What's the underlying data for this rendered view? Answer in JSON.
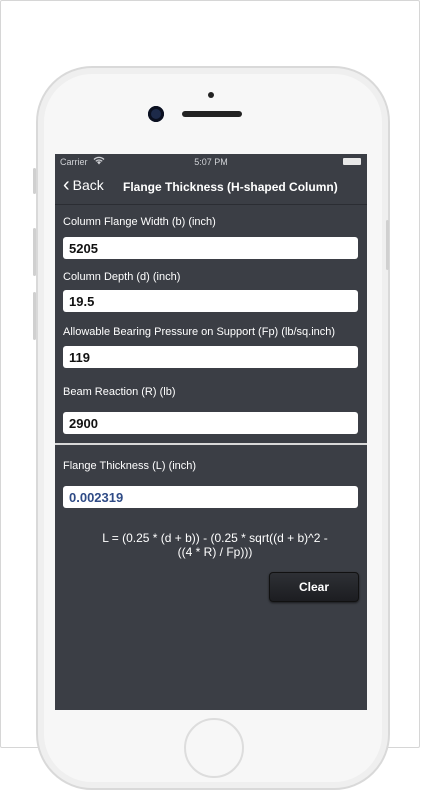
{
  "status": {
    "carrier": "Carrier",
    "time": "5:07 PM"
  },
  "nav": {
    "back_label": "Back",
    "title": "Flange Thickness (H-shaped Column)"
  },
  "fields": [
    {
      "label": "Column Flange Width (b) (inch)",
      "value": "5205"
    },
    {
      "label": "Column Depth (d) (inch)",
      "value": "19.5"
    },
    {
      "label": "Allowable Bearing Pressure on Support (Fp) (lb/sq.inch)",
      "value": "119"
    },
    {
      "label": "Beam Reaction (R) (lb)",
      "value": "2900"
    }
  ],
  "result": {
    "label": "Flange Thickness (L) (inch)",
    "value": "0.002319"
  },
  "formula": {
    "line1": "L = (0.25 * (d + b)) - (0.25 * sqrt((d + b)^2 -",
    "line2": "((4 * R) / Fp)))"
  },
  "clear_label": "Clear",
  "colors": {
    "screen_bg": "#3b3e45",
    "result_text": "#2f4b86"
  },
  "icons": {
    "back": "chevron-left-icon",
    "wifi": "wifi-icon",
    "battery": "battery-icon"
  }
}
